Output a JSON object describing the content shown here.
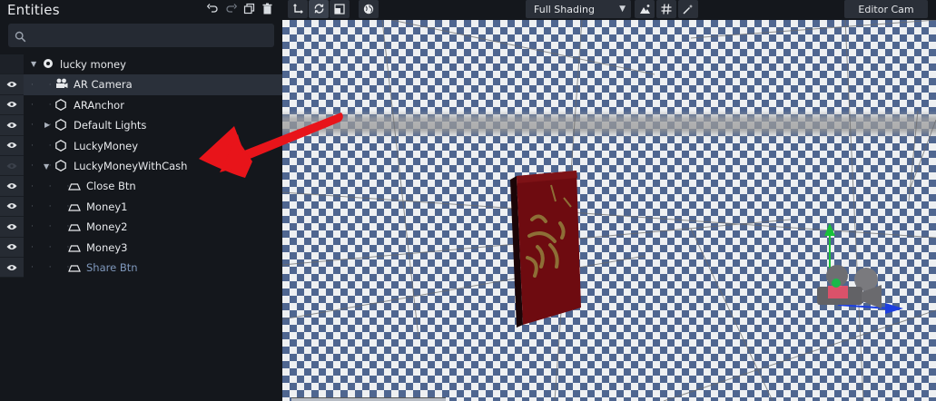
{
  "panel": {
    "title": "Entities",
    "search_placeholder": ""
  },
  "header_icons": [
    "undo-icon",
    "redo-icon",
    "duplicate-icon",
    "trash-icon"
  ],
  "tree": {
    "root": {
      "label": "lucky money",
      "expanded": true
    },
    "items": [
      {
        "label": "AR Camera",
        "icon": "camera-icon",
        "depth": 1,
        "selected": true,
        "visible": true,
        "toggle": ""
      },
      {
        "label": "ARAnchor",
        "icon": "hexagon-icon",
        "depth": 1,
        "selected": false,
        "visible": true,
        "toggle": ""
      },
      {
        "label": "Default Lights",
        "icon": "hexagon-icon",
        "depth": 1,
        "selected": false,
        "visible": true,
        "toggle": "collapsed"
      },
      {
        "label": "LuckyMoney",
        "icon": "hexagon-icon",
        "depth": 1,
        "selected": false,
        "visible": true,
        "toggle": ""
      },
      {
        "label": "LuckyMoneyWithCash",
        "icon": "hexagon-icon",
        "depth": 1,
        "selected": false,
        "visible": false,
        "toggle": "expanded"
      },
      {
        "label": "Close Btn",
        "icon": "plane-icon",
        "depth": 2,
        "selected": false,
        "visible": true,
        "toggle": ""
      },
      {
        "label": "Money1",
        "icon": "plane-icon",
        "depth": 2,
        "selected": false,
        "visible": true,
        "toggle": ""
      },
      {
        "label": "Money2",
        "icon": "plane-icon",
        "depth": 2,
        "selected": false,
        "visible": true,
        "toggle": ""
      },
      {
        "label": "Money3",
        "icon": "plane-icon",
        "depth": 2,
        "selected": false,
        "visible": true,
        "toggle": ""
      },
      {
        "label": "Share Btn",
        "icon": "plane-icon",
        "depth": 2,
        "selected": false,
        "visible": true,
        "toggle": "",
        "dim": true
      }
    ]
  },
  "toolbar": {
    "tools": [
      "move-icon",
      "rotate-icon",
      "scale-icon",
      "globe-icon"
    ],
    "active_tool": "rotate-icon",
    "shading": "Full Shading",
    "view_icons": [
      "lighting-icon",
      "grid-icon",
      "magic-wand-icon"
    ],
    "camera": "Editor Cam"
  },
  "colors": {
    "panel_bg": "#14171c",
    "selected_row": "#2a303a",
    "checker_blue": "#4f6690",
    "checker_light": "#eef0f2",
    "annotation_red": "#e8141a",
    "envelope_red": "#6d0b0f",
    "gizmo_green": "#19c23a",
    "gizmo_blue": "#1d3fe0"
  }
}
